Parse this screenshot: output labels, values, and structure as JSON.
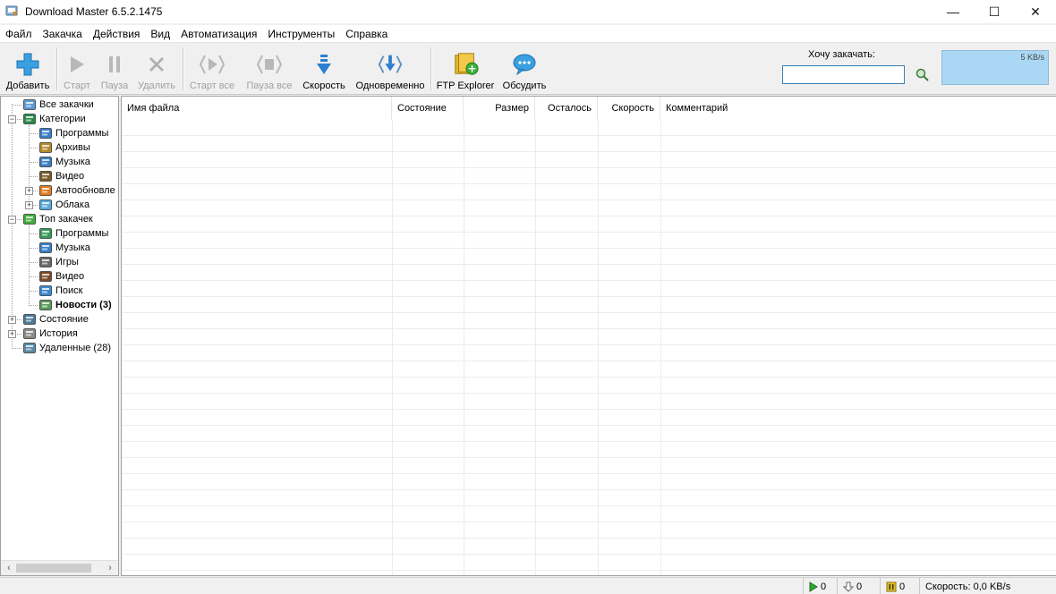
{
  "window": {
    "title": "Download Master 6.5.2.1475",
    "minimize": "—",
    "maximize": "☐",
    "close": "✕"
  },
  "menu": [
    "Файл",
    "Закачка",
    "Действия",
    "Вид",
    "Автоматизация",
    "Инструменты",
    "Справка"
  ],
  "toolbar": {
    "add": "Добавить",
    "start": "Старт",
    "pause": "Пауза",
    "delete": "Удалить",
    "start_all": "Старт все",
    "pause_all": "Пауза все",
    "speed": "Скорость",
    "simultaneous": "Одновременно",
    "ftp": "FTP Explorer",
    "discuss": "Обсудить",
    "want_label": "Хочу закачать:",
    "want_value": "",
    "graph_scale": "5 KB/s"
  },
  "tree": [
    {
      "label": "Все закачки",
      "icon": "all-downloads-icon"
    },
    {
      "label": "Категории",
      "icon": "categories-icon"
    },
    {
      "label": "Программы",
      "icon": "programs-icon"
    },
    {
      "label": "Архивы",
      "icon": "archives-icon"
    },
    {
      "label": "Музыка",
      "icon": "music-icon"
    },
    {
      "label": "Видео",
      "icon": "video-icon"
    },
    {
      "label": "Автообновле",
      "icon": "autoupdate-icon"
    },
    {
      "label": "Облака",
      "icon": "cloud-icon"
    },
    {
      "label": "Топ закачек",
      "icon": "top-downloads-icon"
    },
    {
      "label": "Программы",
      "icon": "top-programs-icon"
    },
    {
      "label": "Музыка",
      "icon": "top-music-icon"
    },
    {
      "label": "Игры",
      "icon": "games-icon"
    },
    {
      "label": "Видео",
      "icon": "top-video-icon"
    },
    {
      "label": "Поиск",
      "icon": "search-icon"
    },
    {
      "label": "Новости (3)",
      "icon": "news-icon"
    },
    {
      "label": "Состояние",
      "icon": "status-icon"
    },
    {
      "label": "История",
      "icon": "history-icon"
    },
    {
      "label": "Удаленные (28)",
      "icon": "trash-icon"
    }
  ],
  "columns": [
    "Имя файла",
    "Состояние",
    "Размер",
    "Осталось",
    "Скорость",
    "Комментарий"
  ],
  "status": {
    "active": "0",
    "queued": "0",
    "paused": "0",
    "speed": "Скорость: 0,0 KB/s"
  },
  "colors": {
    "graph": "#aad8f4",
    "input_border": "#3c7fb1"
  }
}
